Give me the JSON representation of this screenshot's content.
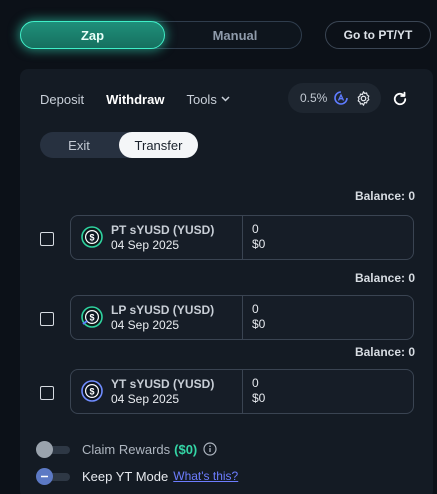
{
  "mode_tabs": {
    "zap": "Zap",
    "manual": "Manual"
  },
  "go_to_pt_yt": "Go to PT/YT",
  "tabs": {
    "deposit": "Deposit",
    "withdraw": "Withdraw",
    "tools": "Tools"
  },
  "slippage": "0.5%",
  "toggle": {
    "exit": "Exit",
    "transfer": "Transfer"
  },
  "balance_label": "Balance: 0",
  "tokens": [
    {
      "name": "PT sYUSD (YUSD)",
      "date": "04 Sep 2025",
      "amount": "0",
      "usd": "$0",
      "icon": "pt-token-icon",
      "ring": "#2fd3a0",
      "checked": false
    },
    {
      "name": "LP sYUSD (YUSD)",
      "date": "04 Sep 2025",
      "amount": "0",
      "usd": "$0",
      "icon": "lp-token-icon",
      "ring": "#2fd3a0",
      "checked": false
    },
    {
      "name": "YT sYUSD (YUSD)",
      "date": "04 Sep 2025",
      "amount": "0",
      "usd": "$0",
      "icon": "yt-token-icon",
      "ring": "#6f8cff",
      "checked": false
    }
  ],
  "claim_rewards": {
    "label": "Claim Rewards",
    "value": "($0)",
    "enabled": false
  },
  "keep_yt": {
    "label": "Keep YT Mode",
    "link": "What's this?",
    "enabled": false
  },
  "colors": {
    "accent": "#30d6b2",
    "link": "#6d7dff",
    "panel": "#141b24"
  }
}
